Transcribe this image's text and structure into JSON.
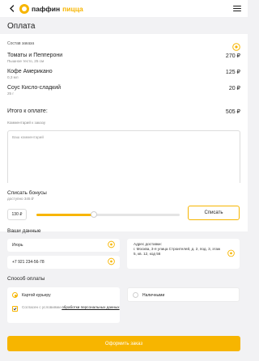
{
  "header": {
    "back_icon": "chevron-left-icon",
    "logo_word": "паффин",
    "logo_word2": "пицца",
    "menu_icon": "hamburger-icon",
    "accent_color": "#f7b500"
  },
  "page": {
    "title": "Оплата"
  },
  "order": {
    "heading": "Состав заказа",
    "items": [
      {
        "name": "Томаты и Пепперони",
        "details": "Пышное тесто, 25 см",
        "price": "270 ₽"
      },
      {
        "name": "Кофе Американо",
        "details": "0,3 мл",
        "price": "125 ₽"
      },
      {
        "name": "Соус Кисло-сладкий",
        "details": "25 г",
        "price": "20 ₽"
      }
    ],
    "total_label": "Итого к оплате:",
    "total_value": "505 ₽",
    "comment_label": "Комментарий к заказу",
    "comment_placeholder": "Ваш комментарий"
  },
  "bonus": {
    "title": "Списать бонусы",
    "available": "доступно 345 ₽",
    "amount": "130 ₽",
    "slider_fraction": 0.4,
    "button_label": "Списать"
  },
  "user_data": {
    "title": "Ваши данные",
    "name_value": "Игорь",
    "phone_value": "+7 921 234-56-78",
    "address_label": "Адрес доставки:",
    "address_value": "г. Москва, 3-я улица Строителей, д. 2, под. 3, этаж 5, кв. 12, код 56"
  },
  "payment": {
    "title": "Способ оплаты",
    "option_card": "Картой курьеру",
    "option_cash": "Наличными",
    "selected": "card",
    "consent_text": "Согласен с условиями",
    "consent_link": "обработки персональных данных",
    "consent_checked": true
  },
  "submit": {
    "label": "Оформить заказ"
  }
}
